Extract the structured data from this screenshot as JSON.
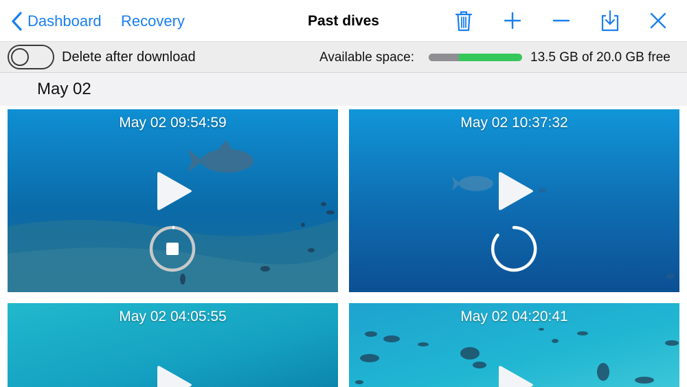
{
  "nav": {
    "back_label": "Dashboard",
    "recovery_label": "Recovery",
    "title": "Past dives"
  },
  "toolbar": {
    "toggle_label": "Delete after download",
    "toggle_on": false,
    "space_label": "Available space:",
    "space_text": "13.5 GB of 20.0 GB free",
    "space_used_fraction": 0.325
  },
  "section": {
    "title": "May 02"
  },
  "colors": {
    "accent": "#1a7ff0",
    "space_used": "#8e8e93",
    "space_free": "#34c759"
  },
  "dives": [
    {
      "time": "May 02 09:54:59",
      "status": "downloading-stop"
    },
    {
      "time": "May 02 10:37:32",
      "status": "loading"
    },
    {
      "time": "May 02 04:05:55",
      "status": "none"
    },
    {
      "time": "May 02 04:20:41",
      "status": "none"
    }
  ]
}
